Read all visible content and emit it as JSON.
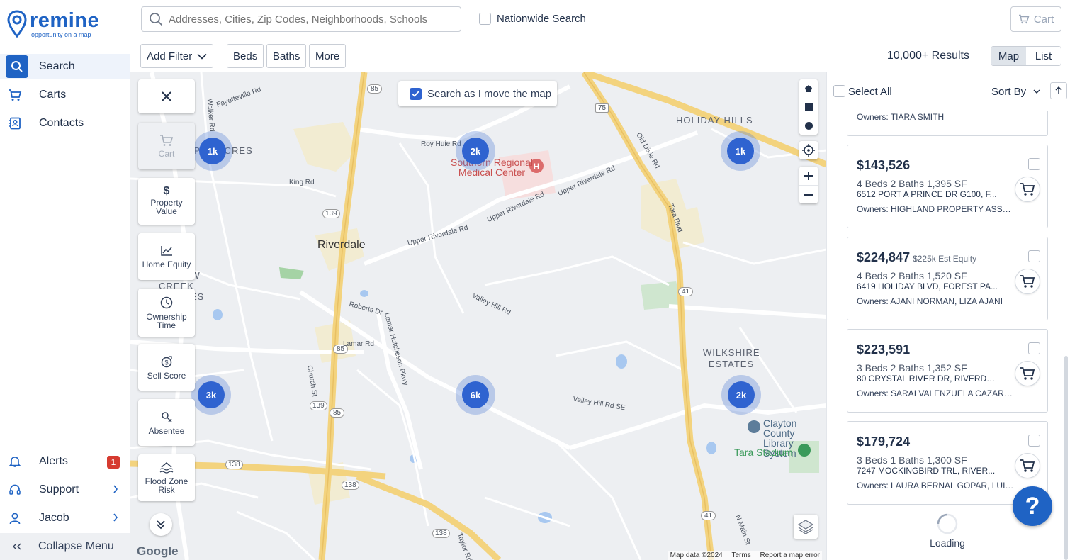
{
  "brand": {
    "name": "remine",
    "tagline": "opportunity on a map"
  },
  "nav": {
    "search": "Search",
    "carts": "Carts",
    "contacts": "Contacts",
    "alerts": "Alerts",
    "alerts_count": "1",
    "support": "Support",
    "user": "Jacob",
    "collapse": "Collapse Menu"
  },
  "topbar": {
    "search_placeholder": "Addresses, Cities, Zip Codes, Neighborhoods, Schools",
    "nationwide": "Nationwide Search",
    "cart": "Cart"
  },
  "filters": {
    "add_filter": "Add Filter",
    "beds": "Beds",
    "baths": "Baths",
    "more": "More",
    "results": "10,000+ Results",
    "view_map": "Map",
    "view_list": "List"
  },
  "map": {
    "search_as_move": "Search as I move the map",
    "tools": {
      "cart": "Cart",
      "property_value": "Property Value",
      "home_equity": "Home Equity",
      "ownership_time": "Ownership Time",
      "sell_score": "Sell Score",
      "absentee": "Absentee",
      "flood_zone": "Flood Zone Risk"
    },
    "clusters": {
      "c1": "1k",
      "c2": "2k",
      "c3": "1k",
      "c4": "3k",
      "c5": "6k",
      "c6": "2k"
    },
    "labels": {
      "riverdale": "Riverdale",
      "holiday_hills": "HOLIDAY HILLS",
      "wilkshire": "WILKSHIRE ESTATES",
      "aspen": "ASPEN ACRES",
      "willow": "WILLOW CREEK ESTATES",
      "hospital": "Southern Regional Medical Center",
      "library": "Clayton County Library System",
      "stadium": "Tara Stadium",
      "upper_riverdale": "Upper Riverdale Rd",
      "roy_huie": "Roy Huie Rd",
      "king": "King Rd",
      "walker": "Walker Rd",
      "fayetteville": "Fayetteville Rd",
      "roberts": "Roberts Dr",
      "lamar": "Lamar Rd",
      "church": "Church St",
      "valley_hill": "Valley Hill Rd",
      "valley_hill_se": "Valley Hill Rd SE",
      "tara": "Tara Blvd",
      "old_dixie": "Old Dixie Rd",
      "lamar_hutcheson": "Lamar Hutcheson Pkwy",
      "north_main": "N Main St",
      "taylor": "Taylor Rd",
      "s_rd": "Lamar Rd"
    },
    "shields": {
      "s85a": "85",
      "s85b": "85",
      "s85c": "85",
      "s139a": "139",
      "s139b": "139",
      "s138a": "138",
      "s138b": "138",
      "s138c": "138",
      "s75": "75",
      "s41a": "41",
      "s41b": "41"
    },
    "google": "Google",
    "map_data": "Map data ©2024",
    "terms": "Terms",
    "report": "Report a map error"
  },
  "panel": {
    "select_all": "Select All",
    "sort_by": "Sort By",
    "partial_owner": "Owners: TIARA SMITH",
    "loading": "Loading",
    "cards": [
      {
        "price": "$143,526",
        "equity": "",
        "specs": "4 Beds 2 Baths 1,395 SF",
        "address": "6512 PORT A PRINCE DR G100, F...",
        "owners": "Owners: HIGHLAND PROPERTY ASSET..."
      },
      {
        "price": "$224,847",
        "equity": "$225k Est Equity",
        "specs": "4 Beds 2 Baths 1,520 SF",
        "address": "6419 HOLIDAY BLVD, FOREST PA...",
        "owners": "Owners: AJANI NORMAN, LIZA AJANI"
      },
      {
        "price": "$223,591",
        "equity": "",
        "specs": "3 Beds 2 Baths 1,352 SF",
        "address": "80 CRYSTAL RIVER DR, RIVERDA...",
        "owners": "Owners: SARAI VALENZUELA CAZARES..."
      },
      {
        "price": "$179,724",
        "equity": "",
        "specs": "3 Beds 1 Baths 1,300 SF",
        "address": "7247 MOCKINGBIRD TRL, RIVER...",
        "owners": "Owners: LAURA BERNAL GOPAR, LUIS ..."
      }
    ]
  },
  "help": "?"
}
